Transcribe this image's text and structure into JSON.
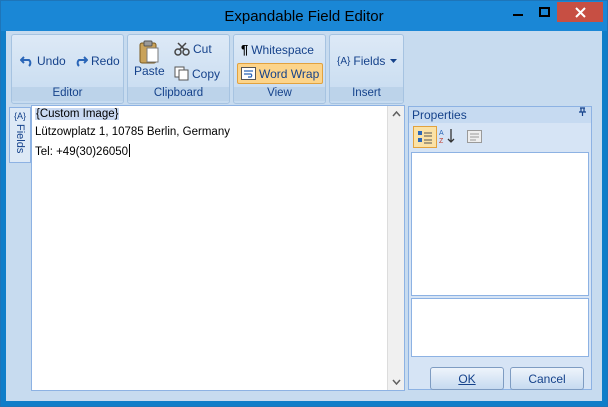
{
  "window": {
    "title": "Expandable Field Editor"
  },
  "ribbon": {
    "editor": {
      "label": "Editor",
      "undo": "Undo",
      "redo": "Redo"
    },
    "clipboard": {
      "label": "Clipboard",
      "paste": "Paste",
      "cut": "Cut",
      "copy": "Copy"
    },
    "view": {
      "label": "View",
      "whitespace": "Whitespace",
      "word_wrap": "Word Wrap",
      "word_wrap_active": true
    },
    "insert": {
      "label": "Insert",
      "fields": "Fields"
    }
  },
  "fields_panel": {
    "tab_label": "Fields",
    "icon_text": "{A}"
  },
  "editor": {
    "lines": [
      "{Custom Image}",
      "Lützowplatz 1, 10785 Berlin, Germany",
      "Tel: +49(30)26050"
    ]
  },
  "properties": {
    "title": "Properties"
  },
  "dialog": {
    "ok": "OK",
    "cancel": "Cancel"
  },
  "colors": {
    "title_bar": "#1a87d6",
    "client": "#c7dbef",
    "accent": "#15428b",
    "active_button": "#fcd48a",
    "close_button": "#c74f43"
  }
}
